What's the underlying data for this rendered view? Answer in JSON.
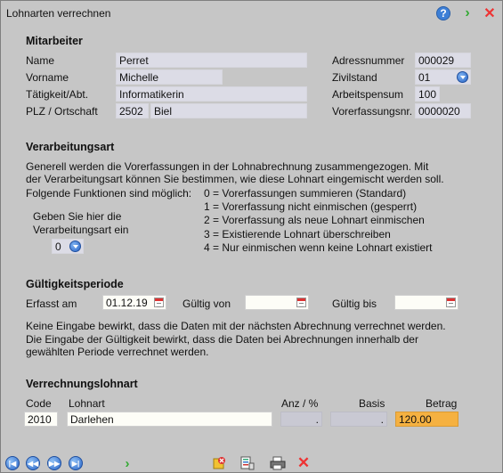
{
  "window": {
    "title": "Lohnarten verrechnen"
  },
  "titlebar_icons": {
    "help": "?",
    "go": "›",
    "close": "✕"
  },
  "mitarbeiter": {
    "heading": "Mitarbeiter",
    "name_label": "Name",
    "name_value": "Perret",
    "vorname_label": "Vorname",
    "vorname_value": "Michelle",
    "taetigkeit_label": "Tätigkeit/Abt.",
    "taetigkeit_value": "Informatikerin",
    "plz_label": "PLZ / Ortschaft",
    "plz_value": "2502",
    "ort_value": "Biel",
    "adressnummer_label": "Adressnummer",
    "adressnummer_value": "000029",
    "zivilstand_label": "Zivilstand",
    "zivilstand_value": "01",
    "arbeitspensum_label": "Arbeitspensum",
    "arbeitspensum_value": "100",
    "vorerfassungsnr_label": "Vorerfassungsnr.",
    "vorerfassungsnr_value": "0000020"
  },
  "verarbeitungsart": {
    "heading": "Verarbeitungsart",
    "line1": "Generell werden die Vorerfassungen in der Lohnabrechnung zusammengezogen. Mit",
    "line2": "der Verarbeitungsart können Sie bestimmen, wie diese Lohnart eingemischt werden soll.",
    "line3": "Folgende Funktionen sind möglich:",
    "prompt_line1": "Geben Sie hier die",
    "prompt_line2": "Verarbeitungsart ein",
    "selected": "0",
    "options": [
      "0 = Vorerfassungen summieren (Standard)",
      "1 = Vorerfassung nicht einmischen (gesperrt)",
      "2 = Vorerfassung als neue Lohnart einmischen",
      "3 = Existierende Lohnart überschreiben",
      "4 = Nur einmischen wenn keine Lohnart existiert"
    ]
  },
  "gueltigkeit": {
    "heading": "Gültigkeitsperiode",
    "erfasst_label": "Erfasst am",
    "erfasst_value": "01.12.19",
    "von_label": "Gültig von",
    "von_value": "",
    "bis_label": "Gültig bis",
    "bis_value": "",
    "note1": "Keine Eingabe bewirkt, dass die Daten mit der nächsten Abrechnung verrechnet werden.",
    "note2": "Die Eingabe der Gültigkeit bewirkt, dass die Daten bei Abrechnungen innerhalb der",
    "note3": "gewählten Periode verrechnet werden."
  },
  "verrechnung": {
    "heading": "Verrechnungslohnart",
    "col_code": "Code",
    "col_lohnart": "Lohnart",
    "col_anz": "Anz / %",
    "col_basis": "Basis",
    "col_betrag": "Betrag",
    "code_value": "2010",
    "lohnart_value": "Darlehen",
    "anz_value": ".",
    "basis_value": ".",
    "betrag_value": "120.00"
  },
  "colors": {
    "background": "#c6c6c6",
    "field": "#dcdce6",
    "highlight": "#f5b141"
  }
}
